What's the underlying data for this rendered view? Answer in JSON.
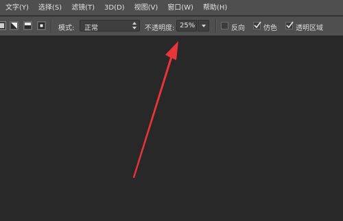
{
  "menu": {
    "items": [
      {
        "id": "type",
        "label": "文字(Y)"
      },
      {
        "id": "select",
        "label": "选择(S)"
      },
      {
        "id": "filter",
        "label": "滤镜(T)"
      },
      {
        "id": "3d",
        "label": "3D(D)"
      },
      {
        "id": "view",
        "label": "视图(V)"
      },
      {
        "id": "window",
        "label": "窗口(W)"
      },
      {
        "id": "help",
        "label": "帮助(H)"
      }
    ]
  },
  "options": {
    "tool_buttons": [
      "new-gradient-icon",
      "diamond-gradient-icon",
      "linear-gradient-icon",
      "radial-gradient-icon"
    ],
    "mode_label": "模式:",
    "mode_value": "正常",
    "opacity_label": "不透明度:",
    "opacity_value": "25%",
    "reverse": {
      "label": "反向",
      "checked": false
    },
    "dither": {
      "label": "仿色",
      "checked": true
    },
    "transparency": {
      "label": "透明区域",
      "checked": true
    }
  },
  "colors": {
    "bar_bg": "#4f4f4f",
    "canvas_bg": "#282828",
    "annotation_arrow": "#e8353a"
  }
}
